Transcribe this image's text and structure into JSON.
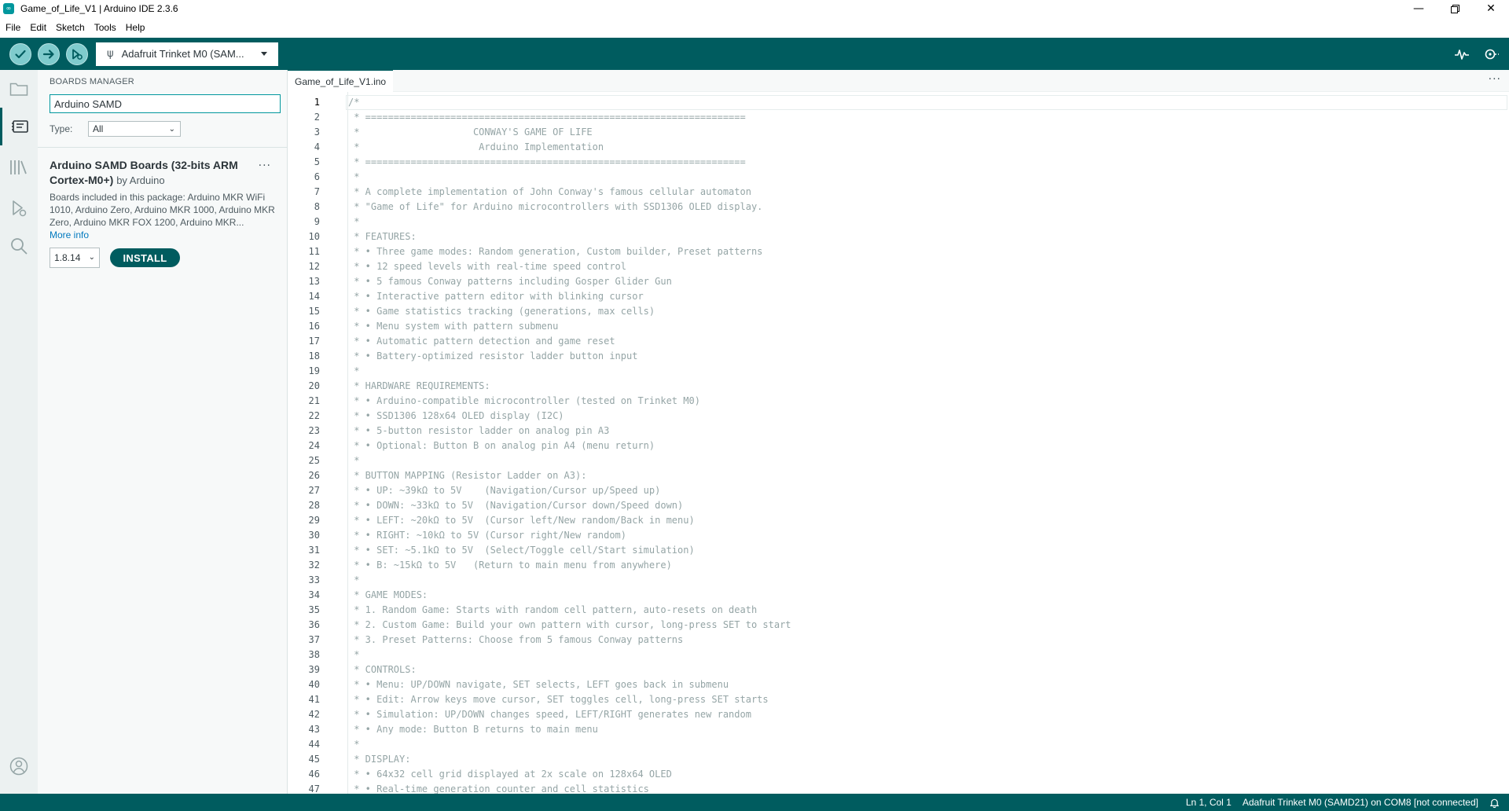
{
  "window": {
    "title": "Game_of_Life_V1 | Arduino IDE 2.3.6",
    "app_icon": "arduino-logo-icon",
    "controls": [
      "minimize-icon",
      "restore-icon",
      "close-icon"
    ]
  },
  "menu": {
    "items": [
      "File",
      "Edit",
      "Sketch",
      "Tools",
      "Help"
    ]
  },
  "toolbar": {
    "buttons": [
      "verify-icon",
      "upload-icon",
      "debug-icon"
    ],
    "board_name": "Adafruit Trinket M0 (SAM...",
    "right_icons": [
      "serial-plotter-icon",
      "serial-monitor-icon"
    ],
    "accent_color": "#005c5f"
  },
  "sidebar": {
    "icons": [
      "folder-icon",
      "boards-manager-icon",
      "library-manager-icon",
      "debug-icon",
      "search-icon",
      "account-icon"
    ],
    "active": "boards-manager-icon"
  },
  "boards_manager": {
    "title": "BOARDS MANAGER",
    "search_value": "Arduino SAMD",
    "type_label": "Type:",
    "type_value": "All",
    "package": {
      "name": "Arduino SAMD Boards (32-bits ARM Cortex-M0+)",
      "by": "by Arduino",
      "description": "Boards included in this package: Arduino MKR WiFi 1010, Arduino Zero, Arduino MKR 1000, Arduino MKR Zero, Arduino MKR FOX 1200, Arduino MKR...",
      "more_info": "More info",
      "version": "1.8.14",
      "install_label": "INSTALL"
    }
  },
  "editor": {
    "tab_name": "Game_of_Life_V1.ino",
    "current_line": 1,
    "line_numbers": [
      "1",
      "2",
      "3",
      "4",
      "5",
      "6",
      "7",
      "8",
      "9",
      "10",
      "11",
      "12",
      "13",
      "14",
      "15",
      "16",
      "17",
      "18",
      "19",
      "20",
      "21",
      "22",
      "23",
      "24",
      "25",
      "26",
      "27",
      "28",
      "29",
      "30",
      "31",
      "32",
      "33",
      "34",
      "35",
      "36",
      "37",
      "38",
      "39",
      "40",
      "41",
      "42",
      "43",
      "44",
      "45",
      "46",
      "47"
    ],
    "lines": [
      "/*",
      " * ===================================================================",
      " *                    CONWAY'S GAME OF LIFE",
      " *                     Arduino Implementation",
      " * ===================================================================",
      " *",
      " * A complete implementation of John Conway's famous cellular automaton",
      " * \"Game of Life\" for Arduino microcontrollers with SSD1306 OLED display.",
      " *",
      " * FEATURES:",
      " * • Three game modes: Random generation, Custom builder, Preset patterns",
      " * • 12 speed levels with real-time speed control",
      " * • 5 famous Conway patterns including Gosper Glider Gun",
      " * • Interactive pattern editor with blinking cursor",
      " * • Game statistics tracking (generations, max cells)",
      " * • Menu system with pattern submenu",
      " * • Automatic pattern detection and game reset",
      " * • Battery-optimized resistor ladder button input",
      " *",
      " * HARDWARE REQUIREMENTS:",
      " * • Arduino-compatible microcontroller (tested on Trinket M0)",
      " * • SSD1306 128x64 OLED display (I2C)",
      " * • 5-button resistor ladder on analog pin A3",
      " * • Optional: Button B on analog pin A4 (menu return)",
      " *",
      " * BUTTON MAPPING (Resistor Ladder on A3):",
      " * • UP: ~39kΩ to 5V    (Navigation/Cursor up/Speed up)",
      " * • DOWN: ~33kΩ to 5V  (Navigation/Cursor down/Speed down)",
      " * • LEFT: ~20kΩ to 5V  (Cursor left/New random/Back in menu)",
      " * • RIGHT: ~10kΩ to 5V (Cursor right/New random)",
      " * • SET: ~5.1kΩ to 5V  (Select/Toggle cell/Start simulation)",
      " * • B: ~15kΩ to 5V   (Return to main menu from anywhere)",
      " *",
      " * GAME MODES:",
      " * 1. Random Game: Starts with random cell pattern, auto-resets on death",
      " * 2. Custom Game: Build your own pattern with cursor, long-press SET to start",
      " * 3. Preset Patterns: Choose from 5 famous Conway patterns",
      " *",
      " * CONTROLS:",
      " * • Menu: UP/DOWN navigate, SET selects, LEFT goes back in submenu",
      " * • Edit: Arrow keys move cursor, SET toggles cell, long-press SET starts",
      " * • Simulation: UP/DOWN changes speed, LEFT/RIGHT generates new random",
      " * • Any mode: Button B returns to main menu",
      " *",
      " * DISPLAY:",
      " * • 64x32 cell grid displayed at 2x scale on 128x64 OLED",
      " * • Real-time generation counter and cell statistics"
    ]
  },
  "status": {
    "position": "Ln 1, Col 1",
    "board_port": "Adafruit Trinket M0 (SAMD21) on COM8 [not connected]",
    "notification_icon": "bell-icon"
  }
}
